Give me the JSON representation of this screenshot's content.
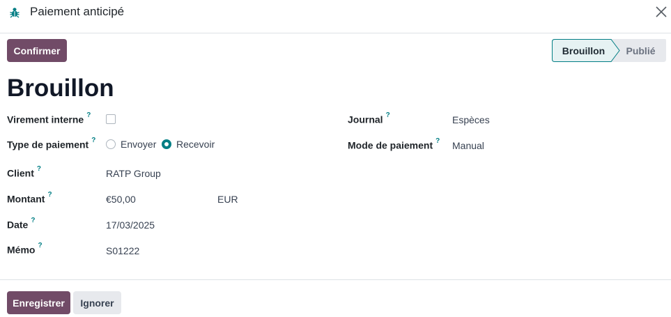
{
  "dialog": {
    "title": "Paiement anticipé",
    "icon": "bug-icon",
    "close_icon": "close-icon"
  },
  "toolbar": {
    "confirm_label": "Confirmer"
  },
  "status_bar": {
    "steps": [
      "Brouillon",
      "Publié"
    ],
    "active": "Brouillon",
    "active_color": "#e6f2f3",
    "active_border": "#017e84"
  },
  "state_title": "Brouillon",
  "help_marker": "?",
  "fields": {
    "internal_transfer": {
      "label": "Virement interne",
      "checked": false
    },
    "payment_type": {
      "label": "Type de paiement",
      "options": [
        "Envoyer",
        "Recevoir"
      ],
      "selected": "Recevoir"
    },
    "customer": {
      "label": "Client",
      "value": "RATP Group"
    },
    "amount": {
      "label": "Montant",
      "value": "€50,00",
      "currency": "EUR"
    },
    "date": {
      "label": "Date",
      "value": "17/03/2025"
    },
    "memo": {
      "label": "Mémo",
      "value": "S01222"
    },
    "journal": {
      "label": "Journal",
      "value": "Espèces"
    },
    "payment_method": {
      "label": "Mode de paiement",
      "value": "Manual"
    }
  },
  "footer": {
    "save_label": "Enregistrer",
    "discard_label": "Ignorer"
  },
  "colors": {
    "primary": "#714b67",
    "accent": "#017e84"
  }
}
